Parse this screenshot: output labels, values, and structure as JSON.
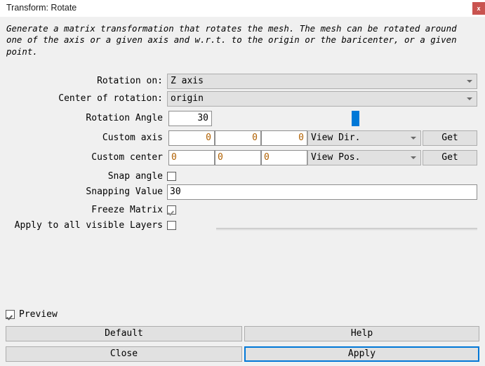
{
  "window": {
    "title": "Transform: Rotate",
    "close_icon": "close-icon",
    "close_label": "x",
    "accent_color": "#0078d7",
    "close_button_color": "#c9534f",
    "number_value_color": "#b06000"
  },
  "description": "Generate a matrix transformation that rotates the mesh. The mesh can be rotated around one of the axis or a given axis and w.r.t. to the origin or the baricenter, or a given point.",
  "form": {
    "rotation_on": {
      "label": "Rotation on:",
      "value": "Z axis",
      "chevron_icon": "chevron-down-icon"
    },
    "center_of_rotation": {
      "label": "Center of rotation:",
      "value": "origin",
      "chevron_icon": "chevron-down-icon"
    },
    "rotation_angle": {
      "label": "Rotation Angle",
      "value": "30",
      "slider_value": 30,
      "slider_min": 0,
      "slider_max": 100
    },
    "custom_axis": {
      "label": "Custom axis",
      "x": "0",
      "y": "0",
      "z": "0",
      "source": "View Dir.",
      "chevron_icon": "chevron-down-icon",
      "get_label": "Get"
    },
    "custom_center": {
      "label": "Custom center",
      "x": "0",
      "y": "0",
      "z": "0",
      "source": "View Pos.",
      "chevron_icon": "chevron-down-icon",
      "get_label": "Get"
    },
    "snap_angle": {
      "label": "Snap angle",
      "checked": false
    },
    "snapping_value": {
      "label": "Snapping Value",
      "value": "30"
    },
    "freeze_matrix": {
      "label": "Freeze Matrix",
      "checked": true
    },
    "apply_all_layers": {
      "label": "Apply to all visible Layers",
      "checked": false
    }
  },
  "footer": {
    "preview": {
      "label": "Preview",
      "checked": true
    },
    "default_label": "Default",
    "help_label": "Help",
    "close_label": "Close",
    "apply_label": "Apply"
  }
}
